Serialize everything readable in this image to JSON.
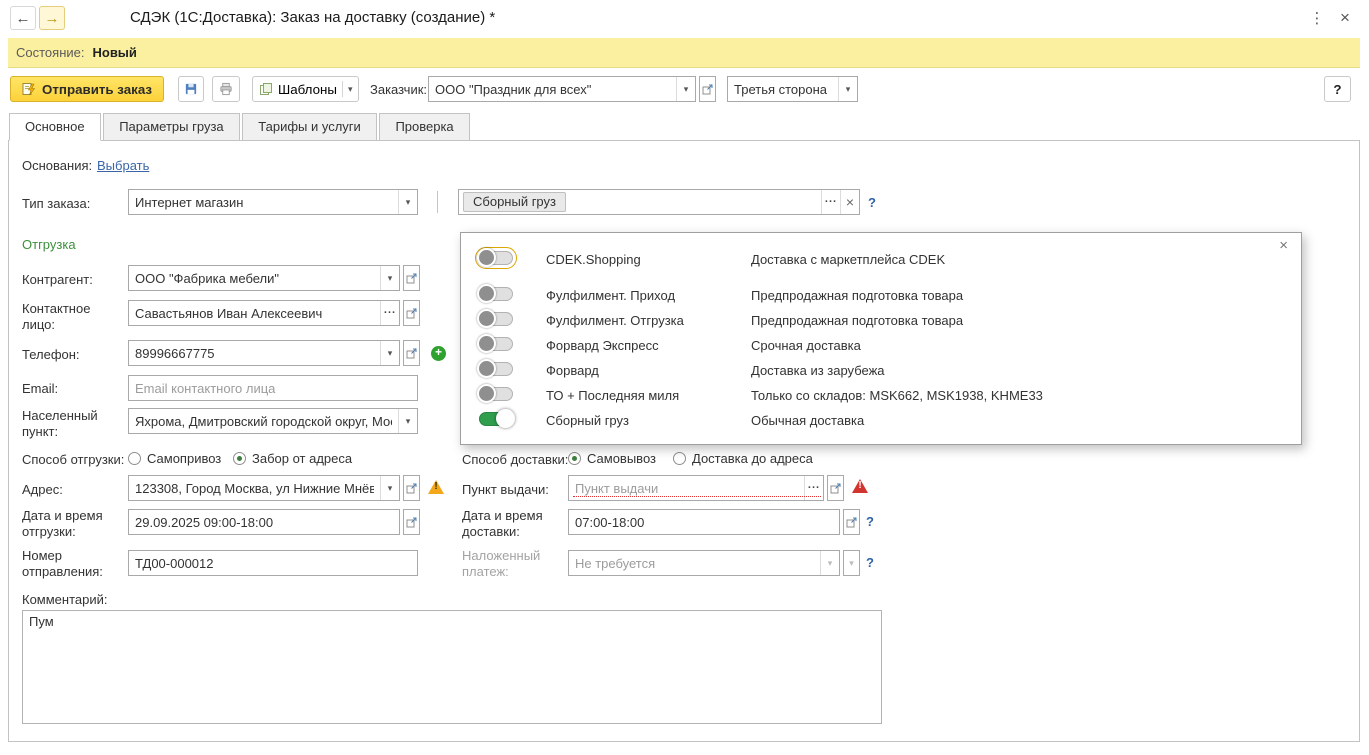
{
  "titlebar": {
    "title": "СДЭК (1С:Доставка): Заказ на доставку (создание) *"
  },
  "statusbar": {
    "label": "Состояние:",
    "value": "Новый"
  },
  "toolbar": {
    "send_order_label": "Отправить заказ",
    "templates_label": "Шаблоны",
    "customer_label": "Заказчик:",
    "customer_value": "ООО \"Праздник для всех\"",
    "third_party_value": "Третья сторона",
    "help_label": "?"
  },
  "tabs": [
    {
      "label": "Основное"
    },
    {
      "label": "Параметры груза"
    },
    {
      "label": "Тарифы и услуги"
    },
    {
      "label": "Проверка"
    }
  ],
  "form": {
    "basis_label": "Основания:",
    "basis_link": "Выбрать",
    "order_type_label": "Тип заказа:",
    "order_type_value": "Интернет магазин",
    "tariff_chip": "Сборный груз",
    "shipping": {
      "header": "Отгрузка",
      "contractor_label": "Контрагент:",
      "contractor_value": "ООО \"Фабрика мебели\"",
      "contact_label": "Контактное лицо:",
      "contact_value": "Савастьянов Иван Алексеевич",
      "phone_label": "Телефон:",
      "phone_value": "89996667775",
      "email_label": "Email:",
      "email_placeholder": "Email контактного лица",
      "city_label": "Населенный пункт:",
      "city_value": "Яхрома, Дмитровский городской округ, Мос",
      "method_label": "Способ отгрузки:",
      "method_options": [
        {
          "label": "Самопривоз",
          "selected": false
        },
        {
          "label": "Забор от адреса",
          "selected": true
        }
      ],
      "address_label": "Адрес:",
      "address_value": "123308, Город Москва, ул Нижние Мнёв",
      "datetime_label": "Дата и время отгрузки:",
      "datetime_value": "29.09.2025 09:00-18:00",
      "number_label": "Номер отправления:",
      "number_value": "ТД00-000012",
      "comment_label": "Комментарий:",
      "comment_value": "Пум"
    },
    "delivery": {
      "method_label": "Способ доставки:",
      "method_options": [
        {
          "label": "Самовывоз",
          "selected": true
        },
        {
          "label": "Доставка до адреса",
          "selected": false
        }
      ],
      "pickup_label": "Пункт выдачи:",
      "pickup_placeholder": "Пункт выдачи",
      "datetime_label": "Дата и время доставки:",
      "datetime_value": "07:00-18:00",
      "cod_label": "Наложенный платеж:",
      "cod_value": "Не требуется"
    }
  },
  "tariff_popup": {
    "items": [
      {
        "label": "CDEK.Shopping",
        "desc": "Доставка с маркетплейса CDEK",
        "on": false
      },
      {
        "label": "Фулфилмент. Приход",
        "desc": "Предпродажная подготовка товара",
        "on": false
      },
      {
        "label": "Фулфилмент. Отгрузка",
        "desc": "Предпродажная подготовка товара",
        "on": false
      },
      {
        "label": "Форвард Экспресс",
        "desc": "Срочная доставка",
        "on": false
      },
      {
        "label": "Форвард",
        "desc": "Доставка из зарубежа",
        "on": false
      },
      {
        "label": "ТО + Последняя миля",
        "desc": "Только со складов: MSK662, MSK1938, KHME33",
        "on": false
      },
      {
        "label": "Сборный груз",
        "desc": "Обычная доставка",
        "on": true
      }
    ]
  }
}
